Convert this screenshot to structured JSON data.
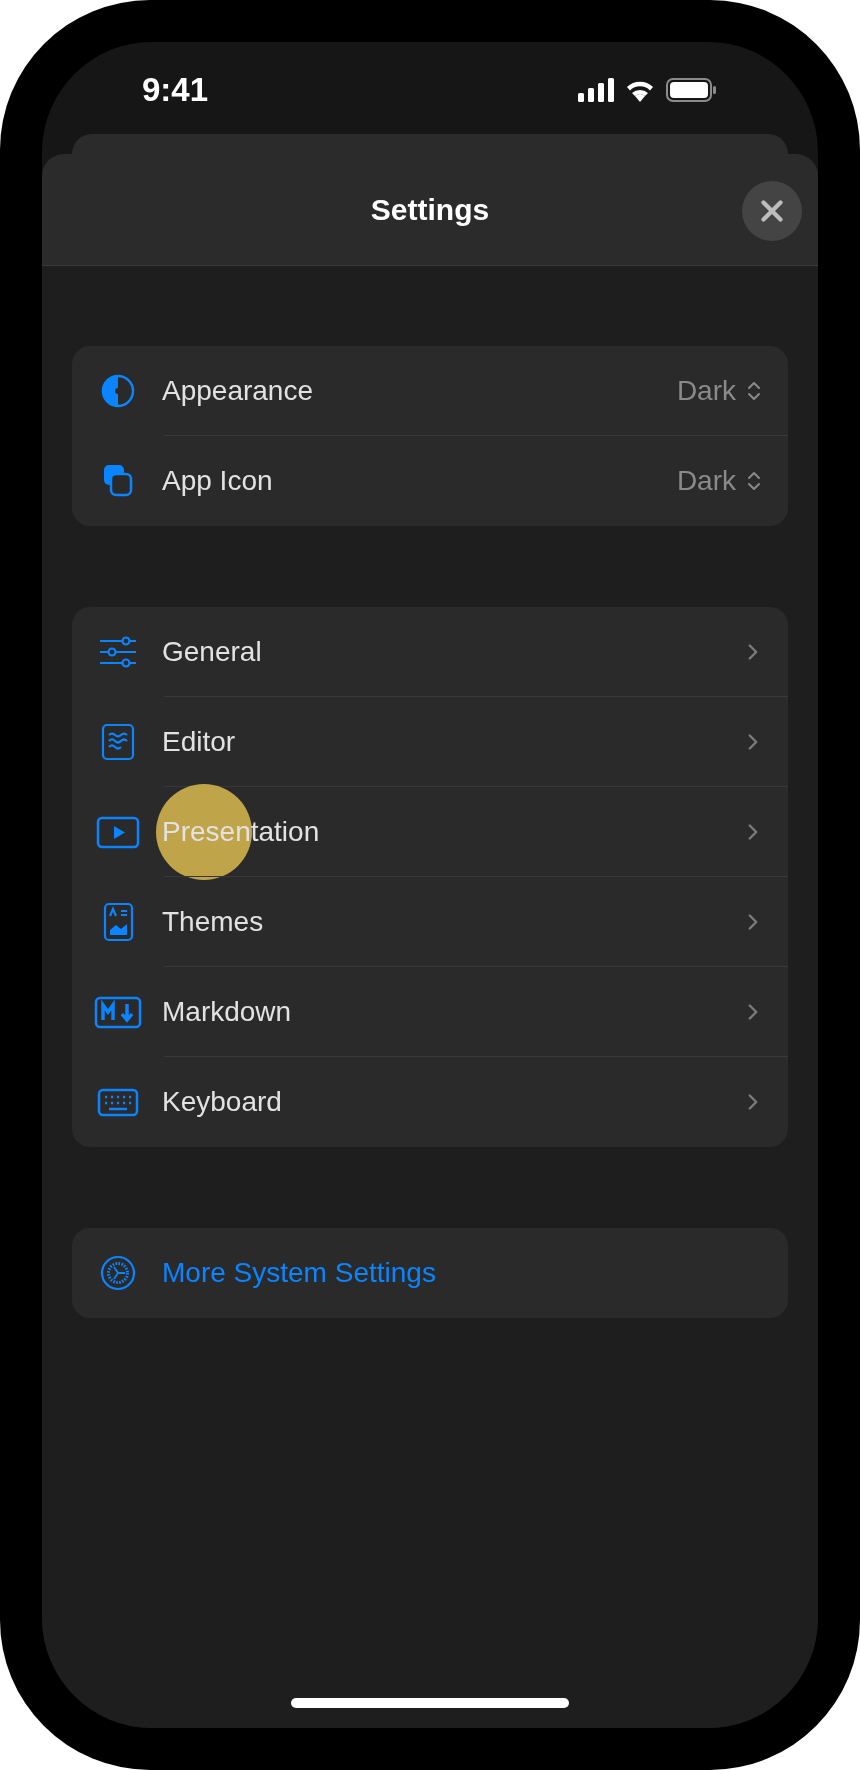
{
  "status_bar": {
    "time": "9:41"
  },
  "sheet": {
    "title": "Settings"
  },
  "groups": [
    {
      "rows": [
        {
          "kind": "picker",
          "label": "Appearance",
          "value": "Dark",
          "touched": false
        },
        {
          "kind": "picker",
          "label": "App Icon",
          "value": "Dark",
          "touched": false
        }
      ]
    },
    {
      "rows": [
        {
          "kind": "link",
          "label": "General",
          "touched": false
        },
        {
          "kind": "link",
          "label": "Editor",
          "touched": false
        },
        {
          "kind": "link",
          "label": "Presentation",
          "touched": true
        },
        {
          "kind": "link",
          "label": "Themes",
          "touched": false
        },
        {
          "kind": "link",
          "label": "Markdown",
          "touched": false
        },
        {
          "kind": "link",
          "label": "Keyboard",
          "touched": false
        }
      ]
    },
    {
      "rows": [
        {
          "kind": "action",
          "label": "More System Settings",
          "touched": false
        }
      ]
    }
  ]
}
